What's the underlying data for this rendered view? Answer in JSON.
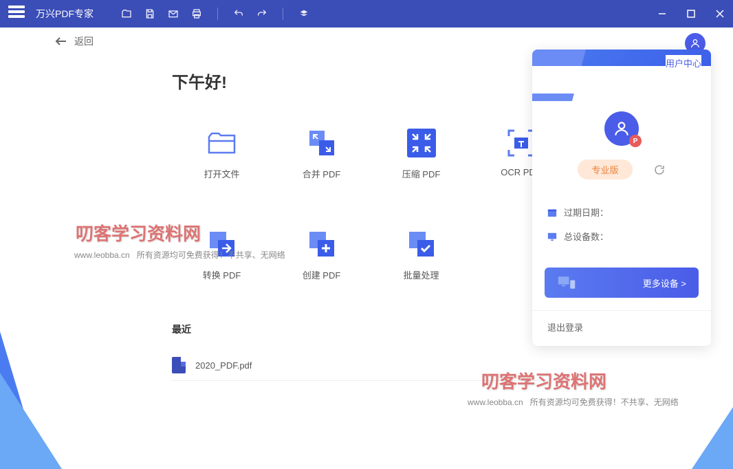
{
  "app": {
    "title": "万兴PDF专家"
  },
  "header": {
    "back": "返回"
  },
  "greeting": "下午好!",
  "actions": [
    {
      "label": "打开文件",
      "icon": "folder-open-icon"
    },
    {
      "label": "合并 PDF",
      "icon": "merge-icon"
    },
    {
      "label": "压缩 PDF",
      "icon": "compress-icon"
    },
    {
      "label": "OCR PDF",
      "icon": "ocr-icon"
    },
    {
      "label": "转换 PDF",
      "icon": "convert-icon"
    },
    {
      "label": "创建 PDF",
      "icon": "create-icon"
    },
    {
      "label": "批量处理",
      "icon": "batch-icon"
    }
  ],
  "recent": {
    "title": "最近",
    "items": [
      {
        "name": "2020_PDF.pdf"
      }
    ]
  },
  "panel": {
    "title": "用户中心",
    "badge": "专业版",
    "avatar_badge": "P",
    "info": [
      {
        "label": "过期日期：",
        "value": ""
      },
      {
        "label": "总设备数：",
        "value": ""
      }
    ],
    "more_devices": "更多设备 >",
    "logout": "退出登录"
  },
  "watermark": {
    "text": "叨客学习资料网",
    "url": "www.leobba.cn",
    "slogan": "所有资源均可免费获得！不共享、无网络"
  }
}
